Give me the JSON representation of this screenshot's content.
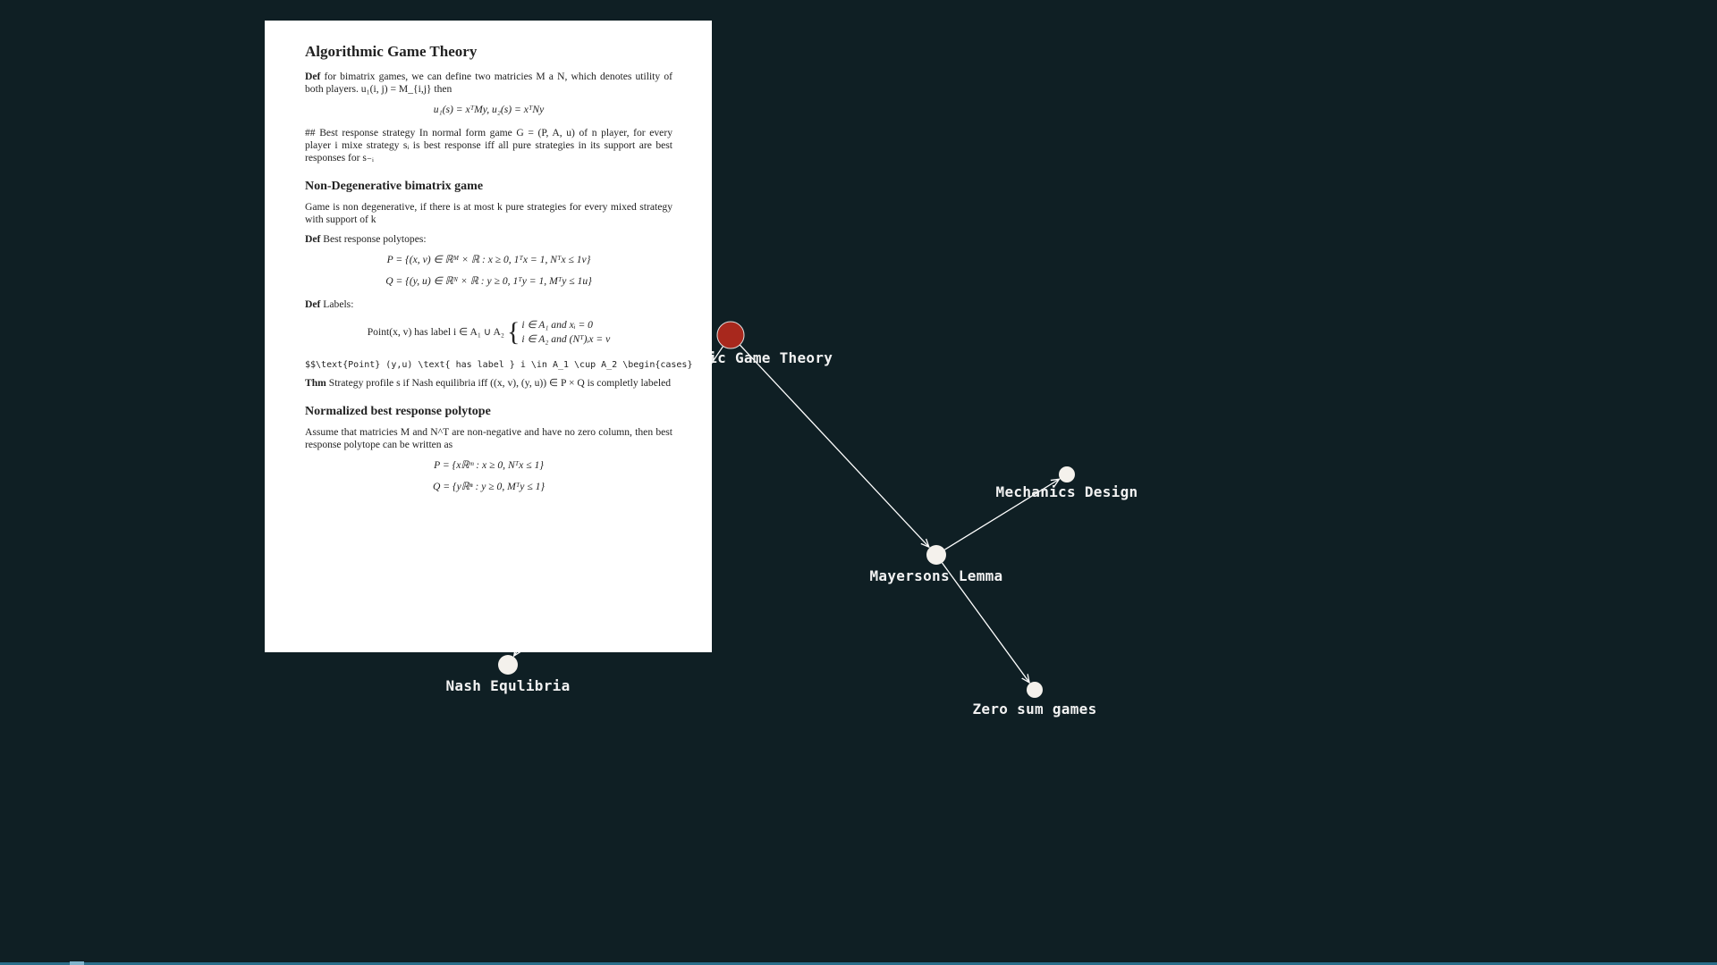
{
  "graph": {
    "colors": {
      "background": "#0f1f24",
      "node": "#f4f1ec",
      "active_node": "#a8281d",
      "edge": "#ffffff",
      "label": "#f2f2f2"
    },
    "nodes": [
      {
        "id": "agt",
        "label": "Algorithmic Game Theory",
        "active": true
      },
      {
        "id": "mayerson",
        "label": "Mayersons Lemma",
        "active": false
      },
      {
        "id": "mechanics",
        "label": "Mechanics Design",
        "active": false
      },
      {
        "id": "zerosum",
        "label": "Zero sum games",
        "active": false
      },
      {
        "id": "nash",
        "label": "Nash Equlibria",
        "active": false
      }
    ],
    "edges": [
      {
        "from": "agt",
        "to": "mayerson"
      },
      {
        "from": "mayerson",
        "to": "mechanics"
      },
      {
        "from": "mayerson",
        "to": "zerosum"
      },
      {
        "from": "agt",
        "to": "nash"
      }
    ]
  },
  "document": {
    "title": "Algorithmic Game Theory",
    "def1_label": "Def",
    "def1_text": " for bimatrix games, we can define two matricies M a N, which denotes utility of both players. u₁(i, j) = M_{i,j} then",
    "eq1": "u₁(s) = xᵀMy, u₂(s) = xᵀNy",
    "best_response_text": "## Best response strategy In normal form game G = (P, A, u) of n player, for every player i mixe strategy sᵢ is best response iff all pure strategies in its support are best responses for s₋ᵢ",
    "h2_nondegenerate": "Non-Degenerative bimatrix game",
    "nondegenerate_text": "Game is non degenerative, if there is at most k pure strategies for every mixed strategy with support of k",
    "def2_label": "Def",
    "def2_text": " Best response polytopes:",
    "eq_P": "P = {(x, v) ∈ ℝᴹ × ℝ : x ≥ 0, 1ᵀx = 1, Nᵀx ≤ 1v}",
    "eq_Q": "Q = {(y, u) ∈ ℝᴺ × ℝ : y ≥ 0, 1ᵀy = 1, Mᵀy ≤ 1u}",
    "def3_label": "Def",
    "def3_text": " Labels:",
    "labels_lhs": "Point(x, v) has label i ∈ A₁ ∪ A₂",
    "labels_case1": "i ∈ A₁ and xᵢ = 0",
    "labels_case2": "i ∈ A₂ and (Nᵀ)ᵢx = v",
    "raw_latex": "$$\\text{Point} (y,u) \\text{ has label } i \\in A_1 \\cup A_2 \\begin{cases}",
    "thm_label": "Thm",
    "thm_text": " Strategy profile s if Nash equilibria iff ((x, v), (y, u)) ∈ P × Q is completly labeled",
    "h2_normalized": "Normalized best response polytope",
    "normalized_text": "Assume that matricies M and N^T are non-negative and have no zero column, then best response polytope can be written as",
    "eq_P2": "P = {xℝᵐ : x ≥ 0, Nᵀx ≤ 1}",
    "eq_Q2": "Q = {yℝⁿ : y ≥ 0, Mᵀy ≤ 1}"
  }
}
